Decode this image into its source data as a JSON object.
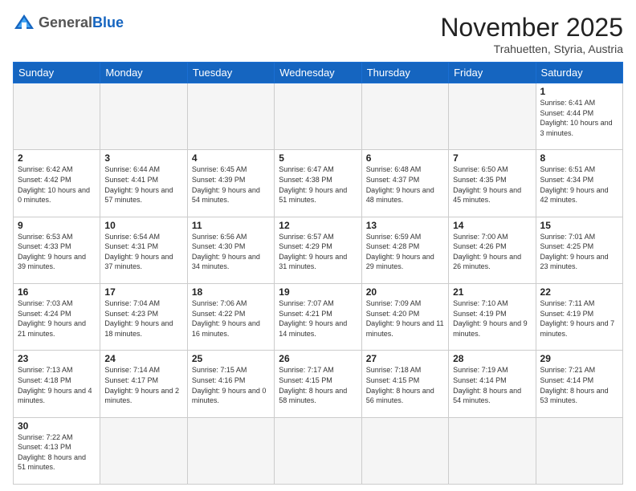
{
  "header": {
    "logo_general": "General",
    "logo_blue": "Blue",
    "month_title": "November 2025",
    "location": "Trahuetten, Styria, Austria"
  },
  "weekdays": [
    "Sunday",
    "Monday",
    "Tuesday",
    "Wednesday",
    "Thursday",
    "Friday",
    "Saturday"
  ],
  "weeks": [
    [
      {
        "day": "",
        "info": ""
      },
      {
        "day": "",
        "info": ""
      },
      {
        "day": "",
        "info": ""
      },
      {
        "day": "",
        "info": ""
      },
      {
        "day": "",
        "info": ""
      },
      {
        "day": "",
        "info": ""
      },
      {
        "day": "1",
        "info": "Sunrise: 6:41 AM\nSunset: 4:44 PM\nDaylight: 10 hours\nand 3 minutes."
      }
    ],
    [
      {
        "day": "2",
        "info": "Sunrise: 6:42 AM\nSunset: 4:42 PM\nDaylight: 10 hours\nand 0 minutes."
      },
      {
        "day": "3",
        "info": "Sunrise: 6:44 AM\nSunset: 4:41 PM\nDaylight: 9 hours\nand 57 minutes."
      },
      {
        "day": "4",
        "info": "Sunrise: 6:45 AM\nSunset: 4:39 PM\nDaylight: 9 hours\nand 54 minutes."
      },
      {
        "day": "5",
        "info": "Sunrise: 6:47 AM\nSunset: 4:38 PM\nDaylight: 9 hours\nand 51 minutes."
      },
      {
        "day": "6",
        "info": "Sunrise: 6:48 AM\nSunset: 4:37 PM\nDaylight: 9 hours\nand 48 minutes."
      },
      {
        "day": "7",
        "info": "Sunrise: 6:50 AM\nSunset: 4:35 PM\nDaylight: 9 hours\nand 45 minutes."
      },
      {
        "day": "8",
        "info": "Sunrise: 6:51 AM\nSunset: 4:34 PM\nDaylight: 9 hours\nand 42 minutes."
      }
    ],
    [
      {
        "day": "9",
        "info": "Sunrise: 6:53 AM\nSunset: 4:33 PM\nDaylight: 9 hours\nand 39 minutes."
      },
      {
        "day": "10",
        "info": "Sunrise: 6:54 AM\nSunset: 4:31 PM\nDaylight: 9 hours\nand 37 minutes."
      },
      {
        "day": "11",
        "info": "Sunrise: 6:56 AM\nSunset: 4:30 PM\nDaylight: 9 hours\nand 34 minutes."
      },
      {
        "day": "12",
        "info": "Sunrise: 6:57 AM\nSunset: 4:29 PM\nDaylight: 9 hours\nand 31 minutes."
      },
      {
        "day": "13",
        "info": "Sunrise: 6:59 AM\nSunset: 4:28 PM\nDaylight: 9 hours\nand 29 minutes."
      },
      {
        "day": "14",
        "info": "Sunrise: 7:00 AM\nSunset: 4:26 PM\nDaylight: 9 hours\nand 26 minutes."
      },
      {
        "day": "15",
        "info": "Sunrise: 7:01 AM\nSunset: 4:25 PM\nDaylight: 9 hours\nand 23 minutes."
      }
    ],
    [
      {
        "day": "16",
        "info": "Sunrise: 7:03 AM\nSunset: 4:24 PM\nDaylight: 9 hours\nand 21 minutes."
      },
      {
        "day": "17",
        "info": "Sunrise: 7:04 AM\nSunset: 4:23 PM\nDaylight: 9 hours\nand 18 minutes."
      },
      {
        "day": "18",
        "info": "Sunrise: 7:06 AM\nSunset: 4:22 PM\nDaylight: 9 hours\nand 16 minutes."
      },
      {
        "day": "19",
        "info": "Sunrise: 7:07 AM\nSunset: 4:21 PM\nDaylight: 9 hours\nand 14 minutes."
      },
      {
        "day": "20",
        "info": "Sunrise: 7:09 AM\nSunset: 4:20 PM\nDaylight: 9 hours\nand 11 minutes."
      },
      {
        "day": "21",
        "info": "Sunrise: 7:10 AM\nSunset: 4:19 PM\nDaylight: 9 hours\nand 9 minutes."
      },
      {
        "day": "22",
        "info": "Sunrise: 7:11 AM\nSunset: 4:19 PM\nDaylight: 9 hours\nand 7 minutes."
      }
    ],
    [
      {
        "day": "23",
        "info": "Sunrise: 7:13 AM\nSunset: 4:18 PM\nDaylight: 9 hours\nand 4 minutes."
      },
      {
        "day": "24",
        "info": "Sunrise: 7:14 AM\nSunset: 4:17 PM\nDaylight: 9 hours\nand 2 minutes."
      },
      {
        "day": "25",
        "info": "Sunrise: 7:15 AM\nSunset: 4:16 PM\nDaylight: 9 hours\nand 0 minutes."
      },
      {
        "day": "26",
        "info": "Sunrise: 7:17 AM\nSunset: 4:15 PM\nDaylight: 8 hours\nand 58 minutes."
      },
      {
        "day": "27",
        "info": "Sunrise: 7:18 AM\nSunset: 4:15 PM\nDaylight: 8 hours\nand 56 minutes."
      },
      {
        "day": "28",
        "info": "Sunrise: 7:19 AM\nSunset: 4:14 PM\nDaylight: 8 hours\nand 54 minutes."
      },
      {
        "day": "29",
        "info": "Sunrise: 7:21 AM\nSunset: 4:14 PM\nDaylight: 8 hours\nand 53 minutes."
      }
    ],
    [
      {
        "day": "30",
        "info": "Sunrise: 7:22 AM\nSunset: 4:13 PM\nDaylight: 8 hours\nand 51 minutes."
      },
      {
        "day": "",
        "info": ""
      },
      {
        "day": "",
        "info": ""
      },
      {
        "day": "",
        "info": ""
      },
      {
        "day": "",
        "info": ""
      },
      {
        "day": "",
        "info": ""
      },
      {
        "day": "",
        "info": ""
      }
    ]
  ]
}
